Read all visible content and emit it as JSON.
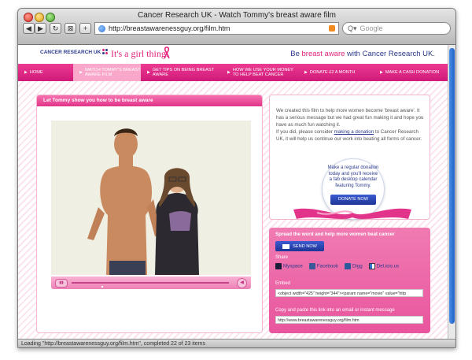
{
  "window": {
    "title": "Cancer Research UK - Watch Tommy's breast aware film",
    "url": "http://breastawarenessguy.org/film.htm",
    "search_placeholder": "Google",
    "status": "Loading \"http://breastawarenessguy.org/film.htm\", completed 22 of 23 items"
  },
  "header": {
    "logo": "CANCER RESEARCH UK",
    "tagline": "It's a girl thing.",
    "brand_pre": "Be ",
    "brand_highlight": "breast aware",
    "brand_post": " with Cancer Research UK."
  },
  "nav": {
    "items": [
      {
        "label": "HOME"
      },
      {
        "label": "WATCH TOMMY'S BREAST AWARE FILM"
      },
      {
        "label": "GET TIPS ON BEING BREAST AWARE"
      },
      {
        "label": "HOW WE USE YOUR MONEY TO HELP BEAT CANCER"
      },
      {
        "label": "DONATE £2 A MONTH"
      },
      {
        "label": "MAKE A CASH DONATION"
      }
    ]
  },
  "player": {
    "title": "Let Tommy show you how to be breast aware"
  },
  "info": {
    "p1": "We created this film to help more women become 'breast aware'. It has a serious message but we had great fun making it and hope you have as much fun watching it.",
    "p2_pre": "If you did, please consider ",
    "p2_link": "making a donation",
    "p2_post": " to Cancer Research UK, it will help us continue our work into beating all forms of cancer.",
    "bubble_text": "Make a regular donation today and you'll receive a fab desktop calendar featuring Tommy.",
    "donate_label": "DONATE NOW"
  },
  "share": {
    "title": "Spread the word and help more women beat cancer",
    "send_label": "SEND NOW",
    "share_label": "Share",
    "links": [
      "Myspace",
      "Facebook",
      "Digg",
      "Del.icio.us"
    ],
    "embed_label": "Embed",
    "embed_code": "<object width=\"425\" height=\"344\"><param name=\"movie\" value=\"http",
    "copy_label": "Copy and paste this link into an email or instant message",
    "link_value": "http://www.breastawarenessguy.org/film.htm"
  }
}
